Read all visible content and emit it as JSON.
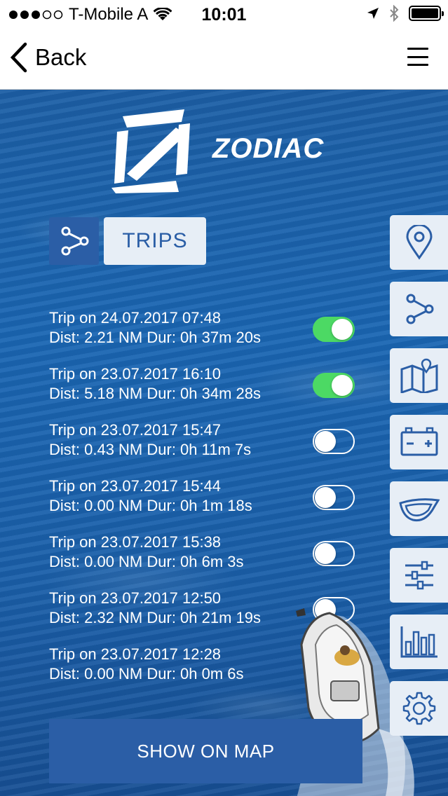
{
  "status_bar": {
    "carrier": "T-Mobile A",
    "time": "10:01"
  },
  "navbar": {
    "back_label": "Back"
  },
  "brand": {
    "name": "ZODIAC"
  },
  "header": {
    "title": "TRIPS"
  },
  "trips": [
    {
      "title": "Trip on 24.07.2017 07:48",
      "detail": "Dist: 2.21 NM Dur: 0h 37m 20s",
      "enabled": true
    },
    {
      "title": "Trip on 23.07.2017 16:10",
      "detail": "Dist: 5.18 NM Dur: 0h 34m 28s",
      "enabled": true
    },
    {
      "title": "Trip on 23.07.2017 15:47",
      "detail": "Dist: 0.43 NM Dur: 0h 11m 7s",
      "enabled": false
    },
    {
      "title": "Trip on 23.07.2017 15:44",
      "detail": "Dist: 0.00 NM Dur: 0h 1m 18s",
      "enabled": false
    },
    {
      "title": "Trip on 23.07.2017 15:38",
      "detail": "Dist: 0.00 NM Dur: 0h 6m 3s",
      "enabled": false
    },
    {
      "title": "Trip on 23.07.2017 12:50",
      "detail": "Dist: 2.32 NM Dur: 0h 21m 19s",
      "enabled": false
    },
    {
      "title": "Trip on 23.07.2017 12:28",
      "detail": "Dist: 0.00 NM Dur: 0h 0m 6s",
      "enabled": false
    }
  ],
  "side_menu": [
    {
      "icon": "location-pin-icon"
    },
    {
      "icon": "route-icon"
    },
    {
      "icon": "map-icon"
    },
    {
      "icon": "battery-icon"
    },
    {
      "icon": "boat-icon"
    },
    {
      "icon": "sliders-icon"
    },
    {
      "icon": "bar-chart-icon"
    },
    {
      "icon": "gear-icon"
    }
  ],
  "actions": {
    "show_on_map": "SHOW ON MAP"
  },
  "colors": {
    "primary": "#2b5ea6",
    "toggle_on": "#4cd964",
    "panel": "#e7eef6"
  }
}
